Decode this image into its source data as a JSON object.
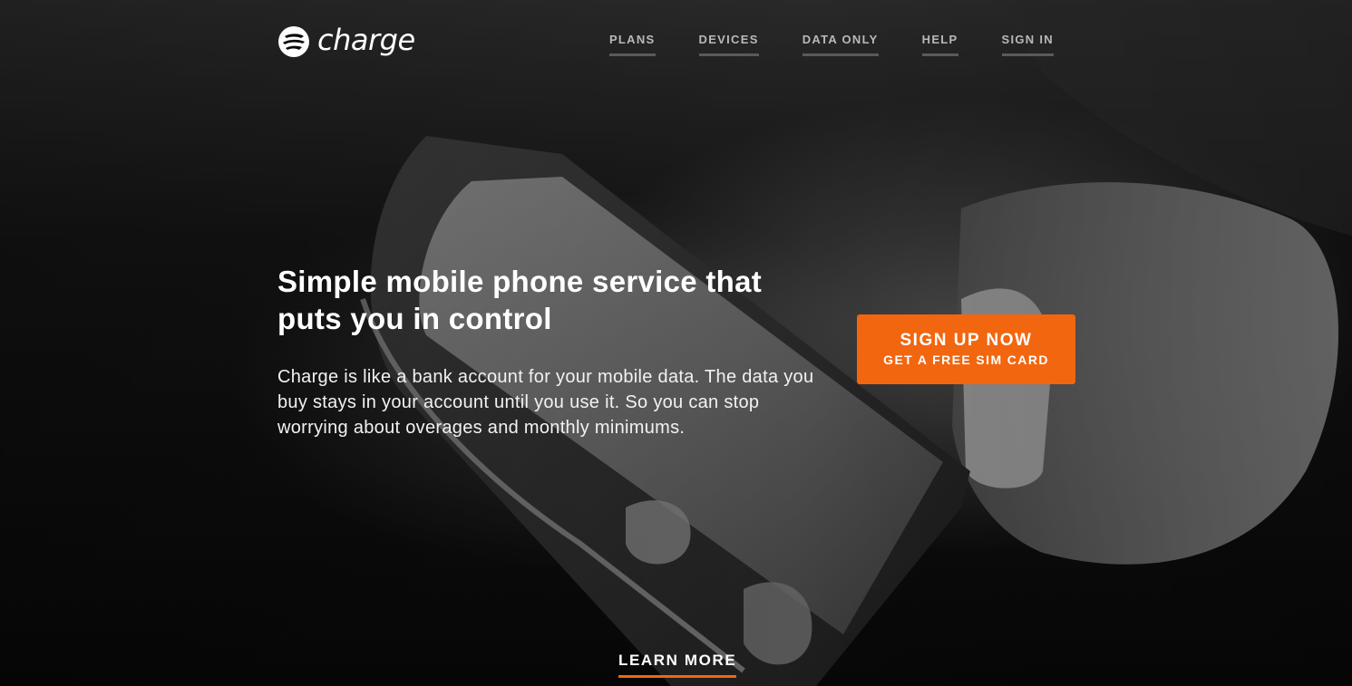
{
  "brand": {
    "name": "charge",
    "icon": "charge-logo-icon",
    "accent_color": "#f2660f"
  },
  "nav": {
    "items": [
      {
        "label": "PLANS"
      },
      {
        "label": "DEVICES"
      },
      {
        "label": "DATA ONLY"
      },
      {
        "label": "HELP"
      },
      {
        "label": "SIGN IN"
      }
    ]
  },
  "hero": {
    "headline": "Simple mobile phone service that puts you in control",
    "body": "Charge is like a bank account for your mobile data. The data you buy stays in your account until you use it. So you can stop worrying about overages and monthly minimums.",
    "background_image": "hand-holding-phone-photo"
  },
  "cta": {
    "main_label": "SIGN UP NOW",
    "sub_label": "GET A FREE SIM CARD"
  },
  "learn_more": {
    "label": "LEARN MORE"
  }
}
